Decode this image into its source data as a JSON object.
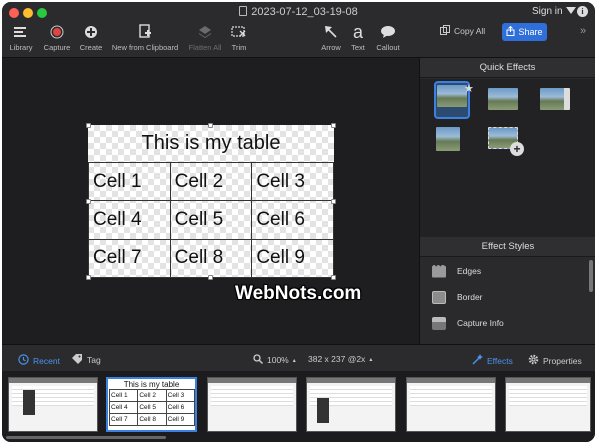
{
  "window": {
    "title": "2023-07-12_03-19-08"
  },
  "toolbar": {
    "library": "Library",
    "capture": "Capture",
    "create": "Create",
    "new_from_clipboard": "New from Clipboard",
    "flatten_all": "Flatten All",
    "trim": "Trim",
    "arrow": "Arrow",
    "text": "Text",
    "text_glyph": "a",
    "callout": "Callout",
    "copy_all": "Copy All",
    "share": "Share",
    "sign_in": "Sign in"
  },
  "canvas": {
    "doc_title": "This is my table",
    "cells": [
      [
        "Cell 1",
        "Cell 2",
        "Cell 3"
      ],
      [
        "Cell 4",
        "Cell 5",
        "Cell 6"
      ],
      [
        "Cell 7",
        "Cell 8",
        "Cell 9"
      ]
    ],
    "watermark": "WebNots.com"
  },
  "right_panel": {
    "quick_effects_title": "Quick Effects",
    "effect_styles_title": "Effect Styles",
    "effect_styles": [
      "Edges",
      "Border",
      "Capture Info"
    ]
  },
  "bottom_bar": {
    "recent": "Recent",
    "tag": "Tag",
    "zoom": "100%",
    "dimensions": "382 x 237 @2x",
    "effects": "Effects",
    "properties": "Properties"
  },
  "filmstrip": {
    "selected_title": "This is my table",
    "cells": [
      [
        "Cell 1",
        "Cell 2",
        "Cell 3"
      ],
      [
        "Cell 4",
        "Cell 5",
        "Cell 6"
      ],
      [
        "Cell 7",
        "Cell 8",
        "Cell 9"
      ]
    ]
  },
  "colors": {
    "accent": "#2e6fd9",
    "selection": "#3b82e0"
  }
}
